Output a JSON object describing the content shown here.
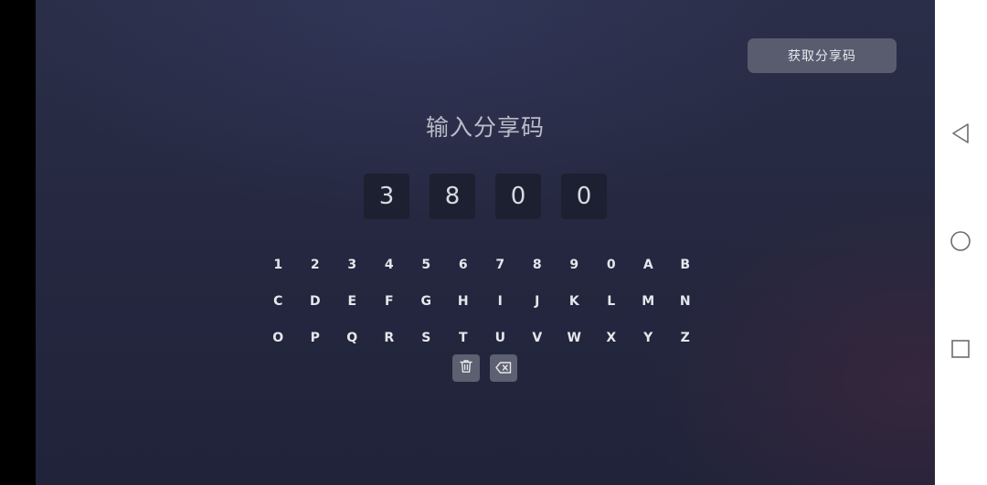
{
  "header": {
    "get_code_label": "获取分享码"
  },
  "main": {
    "title": "输入分享码",
    "code_digits": [
      "3",
      "8",
      "0",
      "0"
    ]
  },
  "keyboard": {
    "rows": [
      [
        "1",
        "2",
        "3",
        "4",
        "5",
        "6",
        "7",
        "8",
        "9",
        "0",
        "A",
        "B"
      ],
      [
        "C",
        "D",
        "E",
        "F",
        "G",
        "H",
        "I",
        "J",
        "K",
        "L",
        "M",
        "N"
      ],
      [
        "O",
        "P",
        "Q",
        "R",
        "S",
        "T",
        "U",
        "V",
        "W",
        "X",
        "Y",
        "Z"
      ]
    ],
    "actions": [
      {
        "icon": "trash-icon"
      },
      {
        "icon": "backspace-icon"
      }
    ]
  },
  "system_nav": {
    "buttons": [
      "back-icon",
      "home-icon",
      "recents-icon"
    ]
  },
  "colors": {
    "background": "#252840",
    "code_box": "#1d2030",
    "button": "#585c6e",
    "action_key": "#5d6070",
    "text": "#e6e7ec"
  }
}
